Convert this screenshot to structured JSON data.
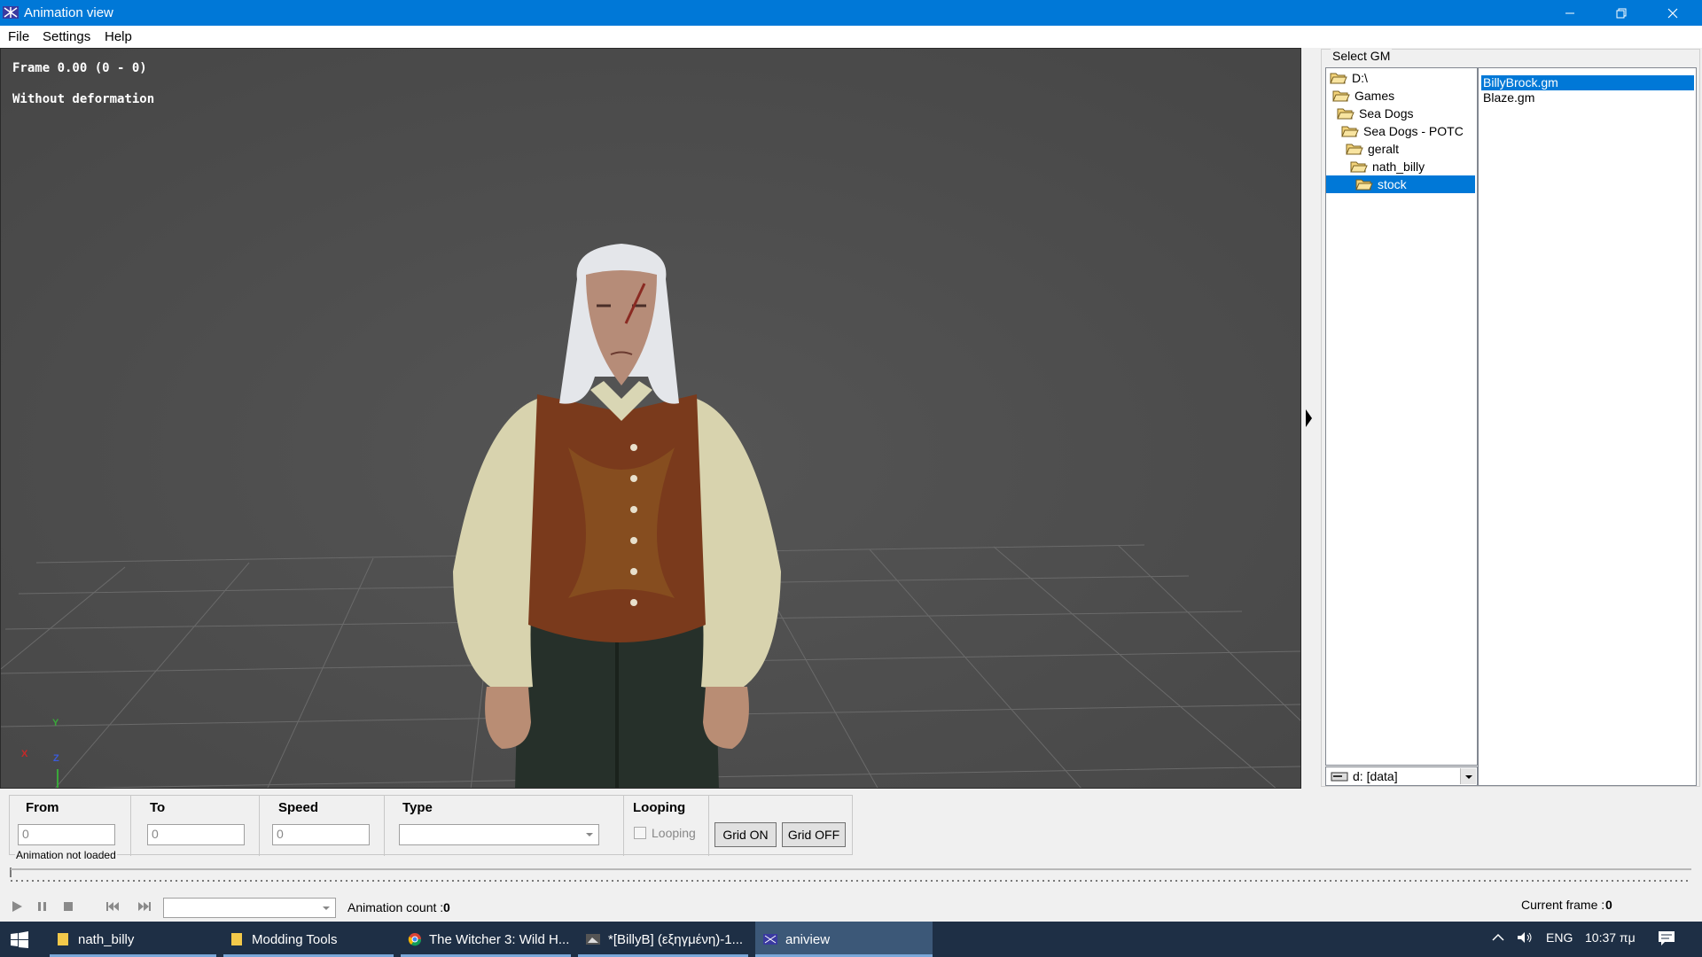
{
  "window": {
    "title": "Animation view"
  },
  "menu": {
    "file": "File",
    "settings": "Settings",
    "help": "Help"
  },
  "viewport": {
    "frame_text": "Frame 0.00 (0 - 0)",
    "deformation_text": "Without deformation",
    "axis": {
      "y": "Y",
      "x": "X",
      "z": "Z"
    }
  },
  "gm_panel": {
    "legend": "Select GM",
    "tree": [
      "D:\\",
      "Games",
      "Sea Dogs",
      "Sea Dogs - POTC",
      "geralt",
      "nath_billy",
      "stock"
    ],
    "selected_folder": "stock",
    "drive": "d: [data]",
    "files": [
      "BillyBrock.gm",
      "Blaze.gm"
    ],
    "selected_file": "BillyBrock.gm"
  },
  "anim": {
    "from_label": "From",
    "from_value": "0",
    "to_label": "To",
    "to_value": "0",
    "speed_label": "Speed",
    "speed_value": "0",
    "type_label": "Type",
    "type_value": "",
    "looping_label": "Looping",
    "looping_checkbox": "Looping",
    "looping_checked": false,
    "grid_on": "Grid ON",
    "grid_off": "Grid OFF",
    "status": "Animation not loaded"
  },
  "transport": {
    "animation_count_label": "Animation count :",
    "animation_count": "0",
    "current_frame_label": "Current frame :",
    "current_frame": "0",
    "animation_select": ""
  },
  "taskbar": {
    "tasks": [
      "nath_billy",
      "Modding Tools",
      "The Witcher 3: Wild H...",
      "*[BillyB] (εξηγμένη)-1...",
      "aniview"
    ],
    "active_task": "aniview",
    "language": "ENG",
    "time": "10:37 πμ"
  },
  "colors": {
    "accent": "#0078d7",
    "viewport_bg": "#4d4d4d",
    "taskbar_bg": "#1e2f45"
  }
}
